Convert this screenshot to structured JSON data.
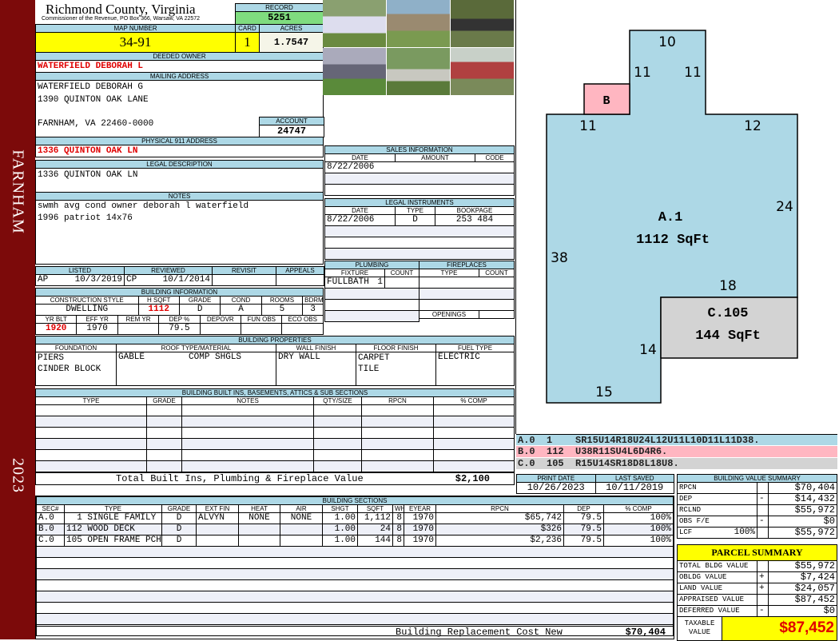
{
  "sidebar": {
    "city": "FARNHAM",
    "year": "2023"
  },
  "header": {
    "county": "Richmond County, Virginia",
    "subtitle": "Commissioner of the Revenue, PO Box 366, Warsaw, VA 22572",
    "record_label": "RECORD",
    "record": "5251",
    "map_label": "MAP NUMBER",
    "map_number": "34-91",
    "card_label": "CARD",
    "card": "1",
    "acres_label": "ACRES",
    "acres": "1.7547"
  },
  "owner": {
    "deeded_label": "DEEDED OWNER",
    "deeded_owner": "WATERFIELD DEBORAH L",
    "mailing_label": "MAILING ADDRESS",
    "mailing": [
      "WATERFIELD DEBORAH G",
      "1390 QUINTON OAK LANE",
      "FARNHAM, VA 22460-0000"
    ],
    "account_label": "ACCOUNT",
    "account": "24747",
    "physical_label": "PHYSICAL 911 ADDRESS",
    "physical": "1336 QUINTON OAK LN"
  },
  "legal": {
    "label": "LEGAL DESCRIPTION",
    "text": "1336 QUINTON OAK LN"
  },
  "notes": {
    "label": "NOTES",
    "lines": [
      "swmh avg cond owner deborah l waterfield",
      "1996 patriot 14x76"
    ]
  },
  "listing": {
    "listed_label": "LISTED",
    "reviewed_label": "REVIEWED",
    "revisit_label": "REVISIT",
    "appeals_label": "APPEALS",
    "listed_by": "AP",
    "listed_date": "10/3/2019",
    "reviewed_by": "CP",
    "reviewed_date": "10/1/2014"
  },
  "building_info": {
    "title": "BUILDING INFORMATION",
    "labels1": [
      "CONSTRUCTION STYLE",
      "H SQFT",
      "GRADE",
      "COND",
      "ROOMS",
      "BDRMS"
    ],
    "values1": [
      "DWELLING",
      "1112",
      "D",
      "A",
      "5",
      "3"
    ],
    "labels2": [
      "YR BLT",
      "EFF YR",
      "REM YR",
      "DEP %",
      "DEPOVR",
      "FUN OBS",
      "ECO OBS"
    ],
    "values2": [
      "1920",
      "1970",
      "",
      "79.5",
      "",
      "",
      ""
    ]
  },
  "sales": {
    "title": "SALES INFORMATION",
    "cols": [
      "DATE",
      "AMOUNT",
      "CODE"
    ],
    "date": "8/22/2006"
  },
  "instruments": {
    "title": "LEGAL INSTRUMENTS",
    "cols": [
      "DATE",
      "TYPE",
      "BOOKPAGE"
    ],
    "date": "8/22/2006",
    "type": "D",
    "bookpage": "253 484"
  },
  "plumbing": {
    "title": "PLUMBING",
    "cols": [
      "FIXTURE",
      "COUNT"
    ],
    "fixture": "FULLBATH",
    "count": "1"
  },
  "fireplaces": {
    "title": "FIREPLACES",
    "cols": [
      "TYPE",
      "COUNT"
    ],
    "openings_label": "OPENINGS"
  },
  "properties": {
    "title": "BUILDING PROPERTIES",
    "cols": [
      "FOUNDATION",
      "ROOF TYPE/MATERIAL",
      "WALL FINISH",
      "FLOOR FINISH",
      "FUEL TYPE"
    ],
    "foundation": [
      "PIERS",
      "CINDER BLOCK"
    ],
    "roof_type": "GABLE",
    "roof_material": "COMP SHGLS",
    "wall": "DRY WALL",
    "floor": [
      "CARPET",
      "TILE"
    ],
    "fuel": "ELECTRIC"
  },
  "builtins": {
    "title": "BUILDING BUILT INS, BASEMENTS, ATTICS & SUB SECTIONS",
    "cols": [
      "TYPE",
      "GRADE",
      "NOTES",
      "QTY/SIZE",
      "RPCN",
      "% COMP"
    ],
    "total_label": "Total Built Ins, Plumbing & Fireplace Value",
    "total": "$2,100"
  },
  "sections": {
    "title": "BUILDING SECTIONS",
    "cols": [
      "SEC#",
      "TYPE",
      "GRADE",
      "EXT FIN",
      "HEAT",
      "AIR",
      "SHGT",
      "SQFT",
      "WHGT",
      "EYEAR",
      "RPCN",
      "DEP",
      "% COMP"
    ],
    "rows": [
      [
        "A.0",
        "  1 SINGLE FAMILY",
        "D",
        "ALVYN",
        "NONE",
        "NONE",
        "1.00",
        "1,112",
        "8",
        "1970",
        "$65,742",
        "79.5",
        "100%"
      ],
      [
        "B.0",
        "112 WOOD DECK",
        "D",
        "",
        "",
        "",
        "1.00",
        "24",
        "8",
        "1970",
        "$326",
        "79.5",
        "100%"
      ],
      [
        "C.0",
        "105 OPEN FRAME PCH",
        "D",
        "",
        "",
        "",
        "1.00",
        "144",
        "8",
        "1970",
        "$2,236",
        "79.5",
        "100%"
      ]
    ],
    "replacement_label": "Building Replacement Cost New",
    "replacement": "$70,404"
  },
  "sketch": {
    "dims": [
      "10",
      "11",
      "11",
      "11",
      "12",
      "24",
      "38",
      "18",
      "14",
      "15"
    ],
    "b_label": "B",
    "a_label": "A.1",
    "a_area": "1112 SqFt",
    "c_label": "C.105",
    "c_area": "144 SqFt",
    "colors": {
      "a": "#add8e6",
      "b": "#ffb6c1",
      "c": "#d3d3d3"
    }
  },
  "patterns": [
    [
      "A.0",
      "1",
      "SR15U14R18U24L12U11L10D11L11D38."
    ],
    [
      "B.0",
      "112",
      "U38R11SU4L6D4R6."
    ],
    [
      "C.0",
      "105",
      "R15U14SR18D8L18U8."
    ]
  ],
  "dates": {
    "print_label": "PRINT DATE",
    "print": "10/26/2023",
    "saved_label": "LAST SAVED",
    "saved": "10/11/2019"
  },
  "bvs": {
    "title": "BUILDING VALUE SUMMARY",
    "rows": [
      [
        "RPCN",
        "",
        "",
        "$70,404"
      ],
      [
        "DEP",
        "",
        "-",
        "$14,432"
      ],
      [
        "RCLND",
        "",
        "",
        "$55,972"
      ],
      [
        "OBS F/E",
        "",
        "-",
        "$0"
      ],
      [
        "LCF",
        "100%",
        "",
        "$55,972"
      ]
    ]
  },
  "parcel": {
    "title": "PARCEL SUMMARY",
    "rows": [
      [
        "TOTAL BLDG VALUE",
        "",
        "$55,972"
      ],
      [
        "OBLDG VALUE",
        "+",
        "$7,424"
      ],
      [
        "LAND VALUE",
        "+",
        "$24,057"
      ],
      [
        "APPRAISED VALUE",
        "",
        "$87,452"
      ],
      [
        "DEFERRED VALUE",
        "-",
        "$0"
      ]
    ],
    "taxable_label": "TAXABLE VALUE",
    "taxable": "$87,452"
  }
}
